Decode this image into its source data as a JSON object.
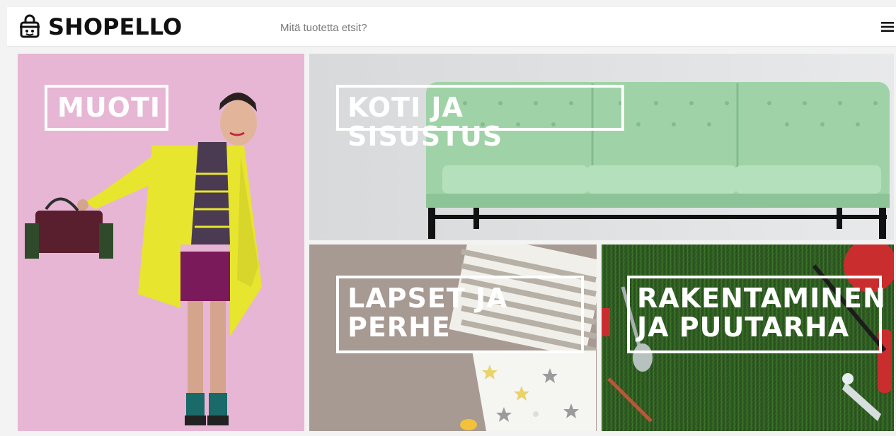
{
  "header": {
    "brand": "SHOPELLO",
    "search_placeholder": "Mitä tuotetta etsit?",
    "menu_icon": "hamburger-menu-icon"
  },
  "categories": [
    {
      "id": "muoti",
      "label": "MUOTI"
    },
    {
      "id": "koti",
      "label": "KOTI JA SISUSTUS"
    },
    {
      "id": "lapset",
      "label": "LAPSET JA\nPERHE"
    },
    {
      "id": "rakentaminen",
      "label": "RAKENTAMINEN\nJA PUUTARHA"
    }
  ],
  "colors": {
    "muoti_bg": "#e7b6d4",
    "koti_bg": "#d6d8da",
    "sofa": "#9fd3a7",
    "lapset_bg": "#a79a92",
    "grass": "#2f5b22",
    "accent_yellow": "#e7e52d"
  }
}
